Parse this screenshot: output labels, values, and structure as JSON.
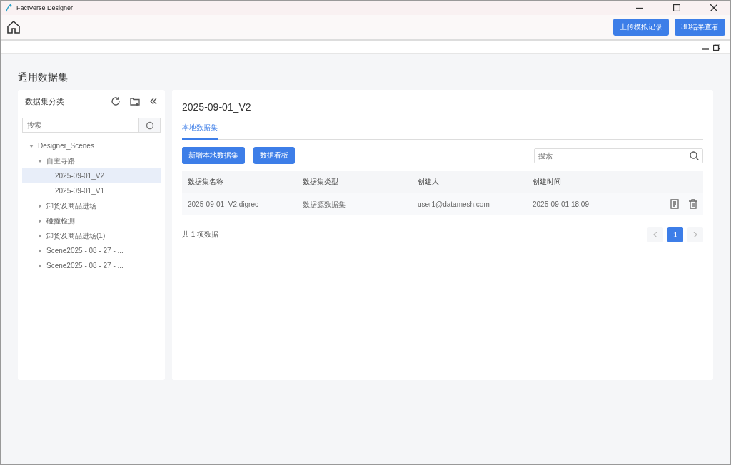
{
  "window": {
    "title": "FactVerse Designer"
  },
  "toolbar": {
    "buttons": [
      "上传模拟记录",
      "3D结果查看"
    ]
  },
  "page_title": "通用数据集",
  "sidebar": {
    "title": "数据集分类",
    "search": {
      "placeholder": "搜索"
    },
    "tree": [
      {
        "label": "Designer_Scenes",
        "expanded": true,
        "selected": false,
        "children": [
          {
            "label": "自主寻路",
            "expanded": true,
            "selected": false,
            "children": [
              {
                "label": "2025-09-01_V2",
                "selected": true
              },
              {
                "label": "2025-09-01_V1",
                "selected": false
              }
            ]
          },
          {
            "label": "卸货及商品进场",
            "expanded": false,
            "selected": false
          },
          {
            "label": "碰撞检测",
            "expanded": false,
            "selected": false
          },
          {
            "label": "卸货及商品进场(1)",
            "expanded": false,
            "selected": false
          },
          {
            "label": "Scene2025 - 08 - 27 - ...",
            "expanded": false,
            "selected": false
          },
          {
            "label": "Scene2025 - 08 - 27 - ...",
            "expanded": false,
            "selected": false
          }
        ]
      }
    ]
  },
  "main": {
    "title": "2025-09-01_V2",
    "tabs": [
      {
        "label": "本地数据集",
        "selected": true
      }
    ],
    "buttons": [
      "新增本地数据集",
      "数据看板"
    ],
    "search": {
      "placeholder": "搜索"
    },
    "table": {
      "columns": [
        "数据集名称",
        "数据集类型",
        "创建人",
        "创建时间"
      ],
      "rows": [
        {
          "cells": [
            "2025-09-01_V2.digrec",
            "数据源数据集",
            "user1@datamesh.com",
            "2025-09-01 18:09"
          ]
        }
      ]
    },
    "total": "共 1 项数据",
    "pagination": {
      "pages": [
        {
          "label": "1",
          "selected": true
        }
      ]
    }
  }
}
